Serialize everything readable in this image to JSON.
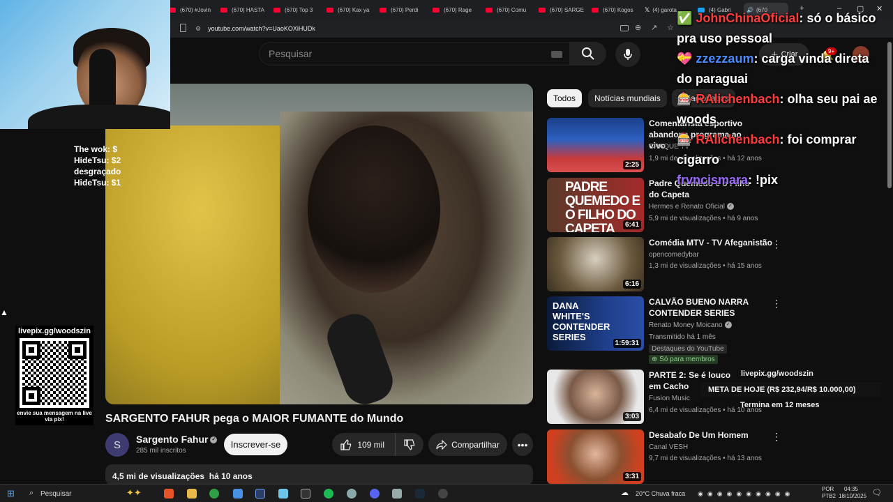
{
  "browser": {
    "tabs": [
      {
        "label": "(670) #Jovin"
      },
      {
        "label": "(670) HASTA"
      },
      {
        "label": "(670) Top 3"
      },
      {
        "label": "(670) Kax ya"
      },
      {
        "label": "(670) Perdi"
      },
      {
        "label": "(670) Rage"
      },
      {
        "label": "(670) Comu"
      },
      {
        "label": "(670) SARGE"
      },
      {
        "label": "(670) Kogos"
      },
      {
        "label": "(4) garota"
      },
      {
        "label": "(4) Gabri"
      },
      {
        "label": "(670"
      }
    ],
    "url": "youtube.com/watch?v=UaoKOXiHUDk"
  },
  "youtube": {
    "search_placeholder": "Pesquisar",
    "notif_count": "9+",
    "create_label": "Criar",
    "video": {
      "title": "SARGENTO FAHUR pega o MAIOR FUMANTE do Mundo",
      "channel": "Sargento Fahur",
      "channel_initial": "S",
      "subscribers": "285 mil inscritos",
      "subscribe_label": "Inscrever-se",
      "likes": "109 mil",
      "share_label": "Compartilhar",
      "views": "4,5 mi de visualizações",
      "age": "há 10 anos"
    },
    "chips": [
      "Todos",
      "Notícias mundiais",
      "Relacionados"
    ],
    "recommendations": [
      {
        "title": "Comentarista esportivo abandona programa ao vivo",
        "channel": "CRAQUE TV",
        "meta": "1,9 mi de visualizações • há 12 anos",
        "duration": "2:25"
      },
      {
        "title": "Padre Quemedo e o Filho do Capeta",
        "channel": "Hermes e Renato Oficial",
        "meta": "5,9 mi de visualizações • há 9 anos",
        "duration": "6:41",
        "thumb_text": "PADRE QUEMEDO E O FILHO DO CAPETA"
      },
      {
        "title": "Comédia MTV - TV Afeganistão",
        "channel": "opencomedybar",
        "meta": "1,3 mi de visualizações • há 15 anos",
        "duration": "6:16"
      },
      {
        "title": "CALVÃO BUENO NARRA CONTENDER SERIES",
        "channel": "Renato Money Moicano",
        "meta": "Transmitido há 1 mês",
        "duration": "1:59:31",
        "badge1": "Destaques do YouTube",
        "badge2": "Só para membros",
        "thumb_text": "DANA WHITE'S CONTENDER SERIES"
      },
      {
        "title": "PARTE 2: Se é louco em Cacho",
        "channel": "Fusion Music",
        "meta": "6,4 mi de visualizações • há 10 anos",
        "duration": "3:03"
      },
      {
        "title": "Desabafo De Um Homem",
        "channel": "Canal VESH",
        "meta": "9,7 mi de visualizações • há 13 anos",
        "duration": "3:31"
      }
    ]
  },
  "stream_overlay": {
    "chat_left": [
      "The wok: $",
      "HideTsu: $2",
      "desgraçado",
      "HideTsu: $1"
    ],
    "qr_title": "livepix.gg/woodszin",
    "qr_caption": "envie sua mensagem na live via pix!",
    "chat": [
      {
        "user": "JohnChinaOficial",
        "text": ": só o básico pra uso pessoal",
        "color": "#ff3b3b"
      },
      {
        "user": "zzezzaum",
        "text": ": carga vinda direta do paraguai",
        "color": "#4a8cff"
      },
      {
        "user": "RAlichenbach",
        "text": ": olha seu pai ae woods",
        "color": "#ff3b3b"
      },
      {
        "user": "RAlichenbach",
        "text": ": foi comprar cigarro",
        "color": "#ff3b3b"
      },
      {
        "user": "frvncismara",
        "text": ": !pix",
        "color": "#9b6bff"
      }
    ],
    "goal_link": "livepix.gg/woodszin",
    "goal_text": "META DE HOJE (R$ 232,94/R$ 10.000,00)",
    "goal_end": "Termina em 12 meses"
  },
  "taskbar": {
    "search_label": "Pesquisar",
    "weather": "20°C  Chuva fraca",
    "lang": "POR",
    "kb": "PTB2",
    "time": "04:35",
    "date": "18/10/2025"
  }
}
